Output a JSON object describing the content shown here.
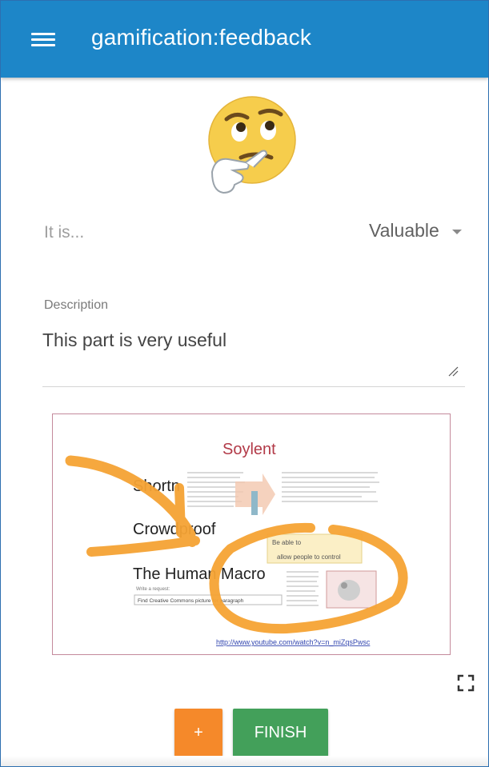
{
  "appbar": {
    "title": "gamification:feedback",
    "menu_icon": "hamburger-menu-icon",
    "color": "#1d86c8"
  },
  "feedback": {
    "emoji_icon": "thinking-face-icon",
    "rating_label": "It is...",
    "rating_value": "Valuable",
    "description_label": "Description",
    "description_value": "This part is very useful"
  },
  "screenshot": {
    "slide_title": "Soylent",
    "rows": [
      "Shortn",
      "Crowdproof",
      "The Human Macro"
    ],
    "request_label": "Write a request:",
    "request_value": "Find Creative Commons picture for paragraph",
    "popup_line_1": "Be able to",
    "popup_line_2": "allow people to control",
    "link_text": "http://www.youtube.com/watch?v=n_miZqsPwsc",
    "annotation_color": "#f5a334"
  },
  "actions": {
    "add_label": "+",
    "finish_label": "FINISH",
    "add_color": "#f5892a",
    "finish_color": "#43a05a"
  },
  "fullscreen_icon": "fullscreen-icon"
}
